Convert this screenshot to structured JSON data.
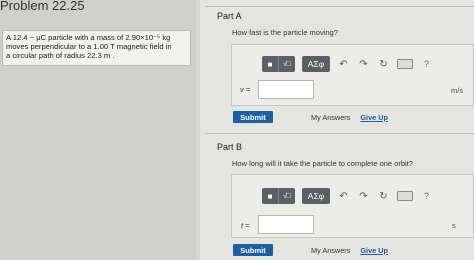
{
  "problem": {
    "title": "Problem 22.25",
    "lines": [
      "A 12.4 − μC particle with a mass of 2.90×10⁻⁵ kg",
      "moves perpendicular to a 1.00 T magnetic field in",
      "a circular path of radius 22.3 m ."
    ]
  },
  "toolbar": {
    "greek": "ΑΣφ",
    "sqrt": "√□",
    "help": "?"
  },
  "partA": {
    "label": "Part A",
    "question": "How fast is the particle moving?",
    "var": "v =",
    "value": "",
    "unit": "m/s",
    "submit": "Submit",
    "my_answers": "My Answers",
    "give_up": "Give Up"
  },
  "partB": {
    "label": "Part B",
    "question": "How long will it take the particle to complete one orbit?",
    "var": "t =",
    "value": "",
    "unit": "s",
    "submit": "Submit",
    "my_answers": "My Answers",
    "give_up": "Give Up"
  }
}
